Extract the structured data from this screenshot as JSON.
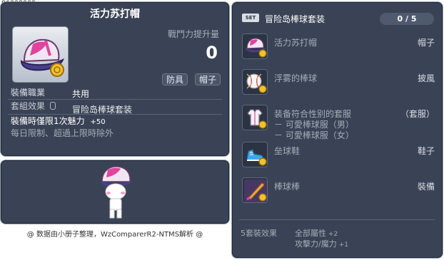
{
  "item_id": "01003909",
  "tooltip": {
    "title": "活力苏打帽",
    "power_label": "戰鬥力提升量",
    "power_value": "0",
    "tags": [
      "防具",
      "帽子"
    ],
    "job_label": "裝備職業",
    "job_value": "共用",
    "set_label": "套組效果",
    "set_value": "冒险岛棒球套装",
    "limit_text": "裝備時僅限1次魅力",
    "limit_value": "+50",
    "limit_note": "每日限制、超過上限時除外"
  },
  "credit": "@ 数据由小册子整理，WzComparerR2-NTMS解析 @",
  "set_panel": {
    "badge": "SET",
    "name": "冒险岛棒球套装",
    "count": "0 / 5",
    "items": [
      {
        "name": "活力苏打帽",
        "kind": "帽子",
        "icon": "cap-icon"
      },
      {
        "name": "浮雾的棒球",
        "kind": "披風",
        "icon": "baseball-icon"
      },
      {
        "name": "装备符合性别的套服",
        "kind": "（套服）",
        "icon": "uniform-icon",
        "subs": [
          "－ 可愛棒球服（男）",
          "－ 可愛棒球服（女）"
        ]
      },
      {
        "name": "垒球鞋",
        "kind": "鞋子",
        "icon": "shoe-icon"
      },
      {
        "name": "棒球棒",
        "kind": "裝備",
        "icon": "bat-icon"
      }
    ],
    "bonus_label": "5套裝效果",
    "bonus_lines": [
      {
        "text": "全部屬性",
        "value": "+2"
      },
      {
        "text": "攻擊力/魔力",
        "value": "+1"
      }
    ]
  },
  "colors": {
    "panel_bg": "#3a4355",
    "panel_border": "#9aa3b3",
    "muted_text": "#a4abb7"
  }
}
